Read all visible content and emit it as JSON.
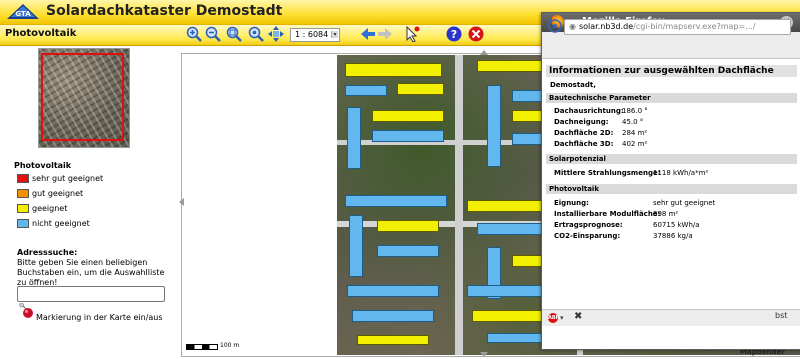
{
  "app": {
    "title": "Solardachkataster Demostadt",
    "section": "Photovoltaik"
  },
  "toolbar": {
    "scale_value": "1 : 6084",
    "tools": [
      "zoom-in-icon",
      "zoom-out-icon",
      "pan-hand-icon",
      "zoom-extent-icon",
      "move-icon",
      "back-arrow-icon",
      "forward-arrow-icon",
      "select-icon",
      "help-icon",
      "close-icon"
    ]
  },
  "legend": {
    "title": "Photovoltaik",
    "items": [
      {
        "label": "sehr gut geeignet",
        "color": "#e11212"
      },
      {
        "label": "gut geeignet",
        "color": "#f29200"
      },
      {
        "label": "geeignet",
        "color": "#f2f000"
      },
      {
        "label": "nicht geeignet",
        "color": "#62b8ee"
      }
    ]
  },
  "address": {
    "title": "Adresssuche:",
    "hint": "Bitte geben Sie einen beliebigen Buchstaben ein, um die Auswahlliste zu öffnen!",
    "input_value": "",
    "marker_label": "Markierung in der Karte ein/aus"
  },
  "map": {
    "scale_label": "100 m",
    "footer": "Mapbender"
  },
  "popup": {
    "window_title": "Mozilla Firefox",
    "url_host": "solar.nb3d.de",
    "url_path": "/cgi-bin/mapserv.exe?map=.../",
    "heading": "Informationen zur ausgewählten Dachfläche",
    "city": "Demostadt,",
    "sections": [
      {
        "title": "Bautechnische Parameter",
        "rows": [
          {
            "label": "Dachausrichtung:",
            "value": "186.0 °"
          },
          {
            "label": "Dachneigung:",
            "value": "45.0 °"
          },
          {
            "label": "Dachfläche 2D:",
            "value": "284 m²"
          },
          {
            "label": "Dachfläche 3D:",
            "value": "402 m²"
          }
        ]
      },
      {
        "title": "Solarpotenzial",
        "rows": [
          {
            "label": "Mittlere Strahlungsmenge:",
            "value": "1118 kWh/a*m²"
          }
        ]
      },
      {
        "title": "Photovoltaik",
        "rows": [
          {
            "label": "Eignung:",
            "value": "sehr gut geeignet"
          },
          {
            "label": "Installierbare Modulfläche:",
            "value": "398 m²"
          },
          {
            "label": "Ertragsprognose:",
            "value": "60715 kWh/a"
          },
          {
            "label": "CO2-Einsparung:",
            "value": "37886 kg/a"
          }
        ]
      }
    ],
    "statusbar": {
      "abp_label": "ABP",
      "right_text": "bst"
    }
  }
}
